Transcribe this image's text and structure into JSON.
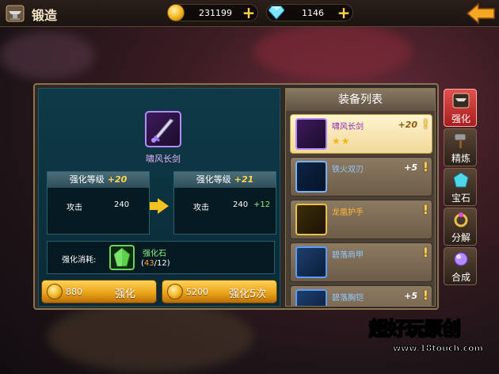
{
  "header": {
    "title": "锻造",
    "gold": "231199",
    "diamonds": "1146"
  },
  "forge": {
    "item_name": "啸风长剑",
    "current": {
      "level_label": "强化等级",
      "level": "+20",
      "stat_name": "攻击",
      "stat_value": "240"
    },
    "next": {
      "level_label": "强化等级",
      "level": "+21",
      "stat_name": "攻击",
      "stat_value": "240",
      "stat_gain": "+12"
    },
    "cost_label": "强化消耗:",
    "material_name": "强化石",
    "material_have": "43",
    "material_need": "/12",
    "material_open": "(",
    "material_close": ")",
    "buttons": [
      {
        "cost": "880",
        "label": "强化"
      },
      {
        "cost": "5200",
        "label": "强化5次"
      }
    ]
  },
  "equipment_list": {
    "title": "装备列表",
    "items": [
      {
        "name": "啸风长剑",
        "level": "+20",
        "stars": "★★",
        "selected": true
      },
      {
        "name": "铁火双刃",
        "level": "+5",
        "stars": "",
        "selected": false
      },
      {
        "name": "龙凰护手",
        "level": "",
        "stars": "",
        "selected": false
      },
      {
        "name": "碧落肩甲",
        "level": "",
        "stars": "",
        "selected": false
      },
      {
        "name": "碧落胸铠",
        "level": "+5",
        "stars": "",
        "selected": false
      }
    ],
    "alert_mark": "!"
  },
  "side_tabs": [
    {
      "label": "强化",
      "active": true
    },
    {
      "label": "精炼",
      "active": false
    },
    {
      "label": "宝石",
      "active": false
    },
    {
      "label": "分解",
      "active": false
    },
    {
      "label": "合成",
      "active": false
    }
  ],
  "watermark": {
    "title": "超好玩原创",
    "url": "www.18touch.com"
  },
  "colors": {
    "gold_accent": "#f2c21e",
    "active_tab": "#d83a3a",
    "purple_quality": "#b38bff",
    "green_gain": "#8ef08a"
  },
  "icons": [
    "anvil-icon",
    "coin-icon",
    "diamond-icon",
    "plus-icon",
    "back-arrow-icon",
    "exclamation-icon",
    "star-icon",
    "enhance-stone-icon"
  ]
}
